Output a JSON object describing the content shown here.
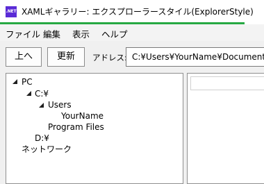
{
  "window": {
    "icon_label": ".NET",
    "title": "XAMLギャラリー: エクスプローラースタイル(ExplorerStyle)"
  },
  "menu": {
    "items": [
      {
        "label": "ファイル"
      },
      {
        "label": "編集"
      },
      {
        "label": "表示"
      },
      {
        "label": "ヘルプ"
      }
    ]
  },
  "toolbar": {
    "up_label": "上へ",
    "refresh_label": "更新",
    "address_label": "アドレス:",
    "address_value": "C:¥Users¥YourName¥Documents"
  },
  "tree": {
    "nodes": [
      {
        "label": "PC",
        "expanded": true
      },
      {
        "label": "C:¥",
        "expanded": true
      },
      {
        "label": "Users",
        "expanded": true
      },
      {
        "label": "YourName"
      },
      {
        "label": "Program Files"
      },
      {
        "label": "D:¥"
      },
      {
        "label": "ネットワーク"
      }
    ]
  },
  "colors": {
    "accent": "#27a943",
    "app_icon": "#5a2bd6"
  }
}
